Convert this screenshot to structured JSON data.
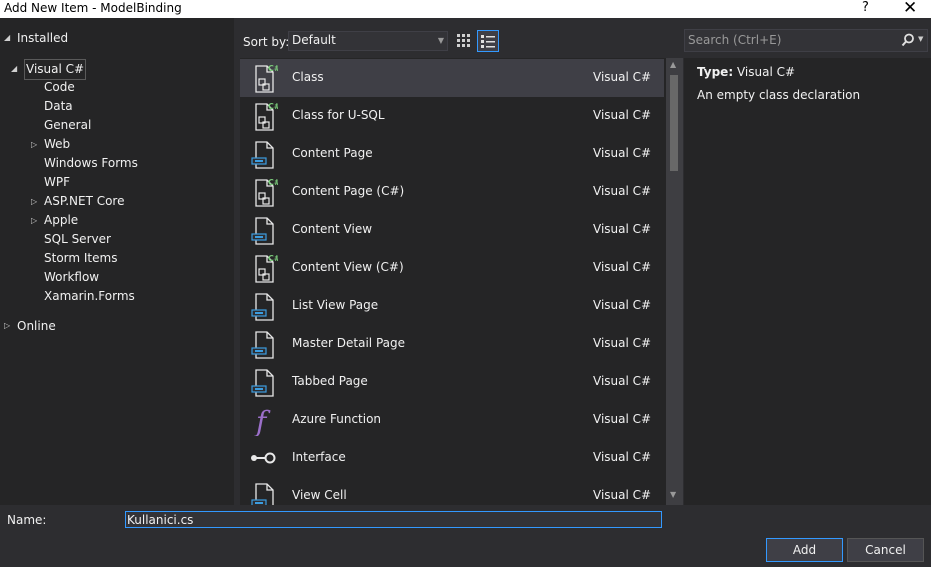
{
  "window": {
    "title": "Add New Item - ModelBinding",
    "help_label": "?",
    "close_label": "✕"
  },
  "left_panel": {
    "installed_label": "Installed",
    "online_label": "Online",
    "tree": [
      {
        "label": "Visual C#",
        "expandable": true,
        "expanded": true,
        "selected": true
      },
      {
        "label": "Code"
      },
      {
        "label": "Data"
      },
      {
        "label": "General"
      },
      {
        "label": "Web",
        "expandable": true
      },
      {
        "label": "Windows Forms"
      },
      {
        "label": "WPF"
      },
      {
        "label": "ASP.NET Core",
        "expandable": true
      },
      {
        "label": "Apple",
        "expandable": true
      },
      {
        "label": "SQL Server"
      },
      {
        "label": "Storm Items"
      },
      {
        "label": "Workflow"
      },
      {
        "label": "Xamarin.Forms"
      }
    ]
  },
  "toolbar": {
    "sort_label": "Sort by:",
    "sort_value": "Default",
    "grid_view_icon": "grid-view-icon",
    "list_view_icon": "list-view-icon"
  },
  "templates": [
    {
      "name": "Class",
      "lang": "Visual C#",
      "icon": "csharp-class-icon",
      "selected": true
    },
    {
      "name": "Class for U-SQL",
      "lang": "Visual C#",
      "icon": "csharp-class-icon"
    },
    {
      "name": "Content Page",
      "lang": "Visual C#",
      "icon": "xaml-page-icon"
    },
    {
      "name": "Content Page (C#)",
      "lang": "Visual C#",
      "icon": "csharp-class-icon"
    },
    {
      "name": "Content View",
      "lang": "Visual C#",
      "icon": "xaml-page-icon"
    },
    {
      "name": "Content View (C#)",
      "lang": "Visual C#",
      "icon": "csharp-class-icon"
    },
    {
      "name": "List View Page",
      "lang": "Visual C#",
      "icon": "xaml-page-icon"
    },
    {
      "name": "Master Detail Page",
      "lang": "Visual C#",
      "icon": "xaml-page-icon"
    },
    {
      "name": "Tabbed Page",
      "lang": "Visual C#",
      "icon": "xaml-page-icon"
    },
    {
      "name": "Azure Function",
      "lang": "Visual C#",
      "icon": "function-icon"
    },
    {
      "name": "Interface",
      "lang": "Visual C#",
      "icon": "interface-icon"
    },
    {
      "name": "View Cell",
      "lang": "Visual C#",
      "icon": "xaml-page-icon"
    }
  ],
  "search": {
    "placeholder": "Search (Ctrl+E)"
  },
  "details": {
    "type_key": "Type:",
    "type_value": "Visual C#",
    "description": "An empty class declaration"
  },
  "bottom": {
    "name_label": "Name:",
    "name_value": "Kullanici.cs",
    "add_label": "Add",
    "cancel_label": "Cancel"
  },
  "colors": {
    "accent": "#3399ff",
    "csharp_green": "#7ccd7c",
    "page_blue": "#3c9de0",
    "function_purple": "#9b6fc9",
    "selected_row": "#3f3f46"
  }
}
